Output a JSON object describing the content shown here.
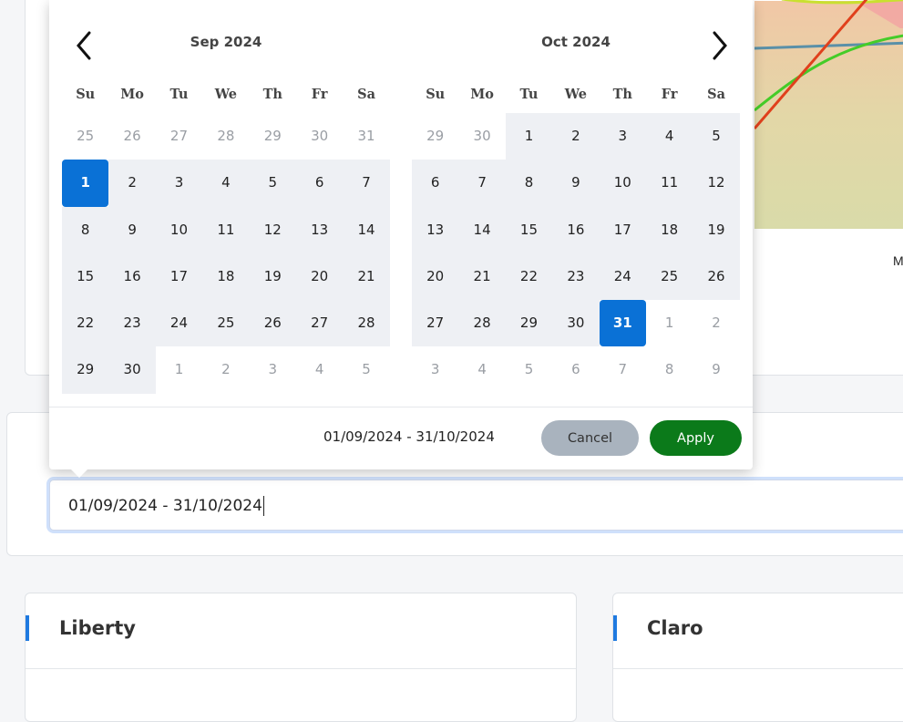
{
  "chart": {
    "x_label_visible": "May"
  },
  "date_picker": {
    "months": [
      {
        "title": "Sep 2024"
      },
      {
        "title": "Oct 2024"
      }
    ],
    "weekday_labels": [
      "Su",
      "Mo",
      "Tu",
      "We",
      "Th",
      "Fr",
      "Sa"
    ],
    "left_days": [
      [
        "25",
        "out"
      ],
      [
        "26",
        "out"
      ],
      [
        "27",
        "out"
      ],
      [
        "28",
        "out"
      ],
      [
        "29",
        "out"
      ],
      [
        "30",
        "out"
      ],
      [
        "31",
        "out"
      ],
      [
        "1",
        "sel"
      ],
      [
        "2",
        "in"
      ],
      [
        "3",
        "in"
      ],
      [
        "4",
        "in"
      ],
      [
        "5",
        "in"
      ],
      [
        "6",
        "in"
      ],
      [
        "7",
        "in"
      ],
      [
        "8",
        "in"
      ],
      [
        "9",
        "in"
      ],
      [
        "10",
        "in"
      ],
      [
        "11",
        "in"
      ],
      [
        "12",
        "in"
      ],
      [
        "13",
        "in"
      ],
      [
        "14",
        "in"
      ],
      [
        "15",
        "in"
      ],
      [
        "16",
        "in"
      ],
      [
        "17",
        "in"
      ],
      [
        "18",
        "in"
      ],
      [
        "19",
        "in"
      ],
      [
        "20",
        "in"
      ],
      [
        "21",
        "in"
      ],
      [
        "22",
        "in"
      ],
      [
        "23",
        "in"
      ],
      [
        "24",
        "in"
      ],
      [
        "25",
        "in"
      ],
      [
        "26",
        "in"
      ],
      [
        "27",
        "in"
      ],
      [
        "28",
        "in"
      ],
      [
        "29",
        "in"
      ],
      [
        "30",
        "in"
      ],
      [
        "1",
        "out"
      ],
      [
        "2",
        "out"
      ],
      [
        "3",
        "out"
      ],
      [
        "4",
        "out"
      ],
      [
        "5",
        "out"
      ]
    ],
    "right_days": [
      [
        "29",
        "out"
      ],
      [
        "30",
        "out"
      ],
      [
        "1",
        "in"
      ],
      [
        "2",
        "in"
      ],
      [
        "3",
        "in"
      ],
      [
        "4",
        "in"
      ],
      [
        "5",
        "in"
      ],
      [
        "6",
        "in"
      ],
      [
        "7",
        "in"
      ],
      [
        "8",
        "in"
      ],
      [
        "9",
        "in"
      ],
      [
        "10",
        "in"
      ],
      [
        "11",
        "in"
      ],
      [
        "12",
        "in"
      ],
      [
        "13",
        "in"
      ],
      [
        "14",
        "in"
      ],
      [
        "15",
        "in"
      ],
      [
        "16",
        "in"
      ],
      [
        "17",
        "in"
      ],
      [
        "18",
        "in"
      ],
      [
        "19",
        "in"
      ],
      [
        "20",
        "in"
      ],
      [
        "21",
        "in"
      ],
      [
        "22",
        "in"
      ],
      [
        "23",
        "in"
      ],
      [
        "24",
        "in"
      ],
      [
        "25",
        "in"
      ],
      [
        "26",
        "in"
      ],
      [
        "27",
        "in"
      ],
      [
        "28",
        "in"
      ],
      [
        "29",
        "in"
      ],
      [
        "30",
        "in"
      ],
      [
        "31",
        "sel"
      ],
      [
        "1",
        "out"
      ],
      [
        "2",
        "out"
      ],
      [
        "3",
        "out"
      ],
      [
        "4",
        "out"
      ],
      [
        "5",
        "out"
      ],
      [
        "6",
        "out"
      ],
      [
        "7",
        "out"
      ],
      [
        "8",
        "out"
      ],
      [
        "9",
        "out"
      ]
    ],
    "range_text": "01/09/2024 - 31/10/2024",
    "cancel_label": "Cancel",
    "apply_label": "Apply",
    "prev_icon": "chevron-left-icon",
    "next_icon": "chevron-right-icon"
  },
  "date_input": {
    "value": "01/09/2024 - 31/10/2024"
  },
  "panels": [
    {
      "title": "Liberty"
    },
    {
      "title": "Claro"
    }
  ],
  "colors": {
    "accent": "#0a71d6",
    "apply": "#0b7a1a",
    "cancel": "#a9b3be",
    "range_bg": "#eef0f4"
  }
}
